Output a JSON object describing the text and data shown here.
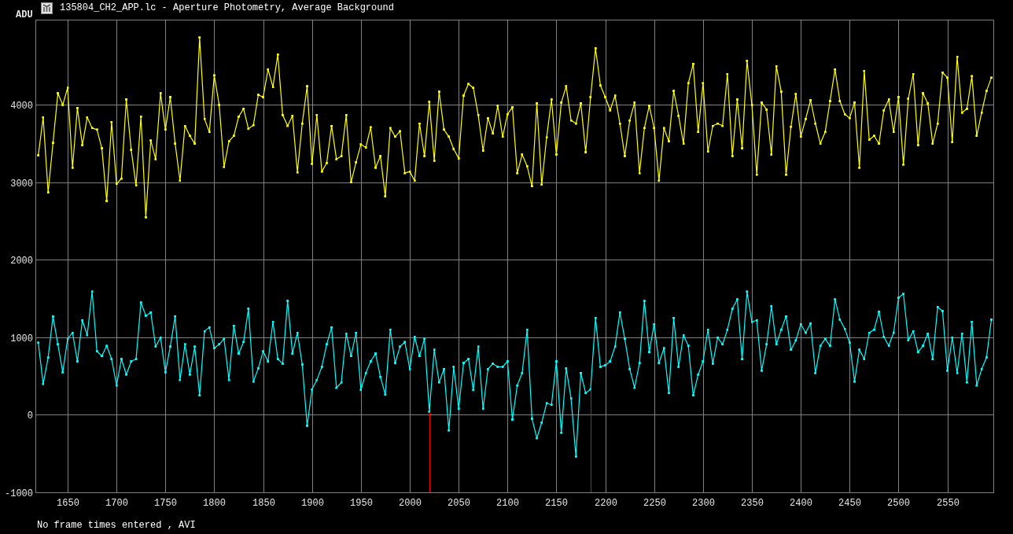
{
  "window": {
    "title": "135804_CH2_APP.lc - Aperture Photometry, Average Background"
  },
  "chart": {
    "chart_data": {
      "type": "line",
      "ylabel": "ADU",
      "x": [
        1620,
        1625,
        1630,
        1635,
        1640,
        1645,
        1650,
        1655,
        1660,
        1665,
        1670,
        1675,
        1680,
        1685,
        1690,
        1695,
        1700,
        1705,
        1710,
        1715,
        1720,
        1725,
        1730,
        1735,
        1740,
        1745,
        1750,
        1755,
        1760,
        1765,
        1770,
        1775,
        1780,
        1785,
        1790,
        1795,
        1800,
        1805,
        1810,
        1815,
        1820,
        1825,
        1830,
        1835,
        1840,
        1845,
        1850,
        1855,
        1860,
        1865,
        1870,
        1875,
        1880,
        1885,
        1890,
        1895,
        1900,
        1905,
        1910,
        1915,
        1920,
        1925,
        1930,
        1935,
        1940,
        1945,
        1950,
        1955,
        1960,
        1965,
        1970,
        1975,
        1980,
        1985,
        1990,
        1995,
        2000,
        2005,
        2010,
        2015,
        2020,
        2025,
        2030,
        2035,
        2040,
        2045,
        2050,
        2055,
        2060,
        2065,
        2070,
        2075,
        2080,
        2085,
        2090,
        2095,
        2100,
        2105,
        2110,
        2115,
        2120,
        2125,
        2130,
        2135,
        2140,
        2145,
        2150,
        2155,
        2160,
        2165,
        2170,
        2175,
        2180,
        2185,
        2190,
        2195,
        2200,
        2205,
        2210,
        2215,
        2220,
        2225,
        2230,
        2235,
        2240,
        2245,
        2250,
        2255,
        2260,
        2265,
        2270,
        2275,
        2280,
        2285,
        2290,
        2295,
        2300,
        2305,
        2310,
        2315,
        2320,
        2325,
        2330,
        2335,
        2340,
        2345,
        2350,
        2355,
        2360,
        2365,
        2370,
        2375,
        2380,
        2385,
        2390,
        2395,
        2400,
        2405,
        2410,
        2415,
        2420,
        2425,
        2430,
        2435,
        2440,
        2445,
        2450,
        2455,
        2460,
        2465,
        2470,
        2475,
        2480,
        2485,
        2490,
        2495,
        2500,
        2505,
        2510,
        2515,
        2520,
        2525,
        2530,
        2535,
        2540,
        2545,
        2550,
        2555,
        2560,
        2565,
        2570,
        2575,
        2580,
        2585,
        2590,
        2595
      ],
      "series": [
        {
          "color": "#ffff00",
          "values": [
            3350,
            3840,
            2870,
            3510,
            4150,
            4000,
            4220,
            3190,
            3960,
            3480,
            3840,
            3700,
            3680,
            3440,
            2760,
            3780,
            2980,
            3050,
            4070,
            3420,
            2960,
            3850,
            2550,
            3540,
            3300,
            4150,
            3680,
            4100,
            3500,
            3020,
            3730,
            3600,
            3500,
            4870,
            3820,
            3650,
            4380,
            4000,
            3200,
            3530,
            3600,
            3850,
            3950,
            3690,
            3740,
            4130,
            4100,
            4460,
            4230,
            4650,
            3870,
            3730,
            3860,
            3130,
            3760,
            4240,
            3240,
            3870,
            3140,
            3250,
            3730,
            3300,
            3340,
            3870,
            3000,
            3260,
            3490,
            3450,
            3710,
            3190,
            3340,
            2820,
            3700,
            3590,
            3660,
            3120,
            3140,
            3020,
            3760,
            3340,
            4040,
            3280,
            4170,
            3680,
            3590,
            3430,
            3310,
            4120,
            4270,
            4220,
            3870,
            3410,
            3830,
            3630,
            3990,
            3590,
            3880,
            3970,
            3120,
            3360,
            3210,
            2950,
            4020,
            2970,
            3580,
            4070,
            3360,
            4030,
            4240,
            3800,
            3760,
            4020,
            3390,
            4100,
            4730,
            4250,
            4100,
            3930,
            4120,
            3760,
            3340,
            3800,
            4030,
            3120,
            3700,
            3990,
            3700,
            3020,
            3700,
            3530,
            4180,
            3860,
            3500,
            4280,
            4530,
            3650,
            4280,
            3400,
            3730,
            3760,
            3730,
            4400,
            3340,
            4070,
            3440,
            4570,
            4000,
            3100,
            4030,
            3940,
            3360,
            4500,
            4170,
            3100,
            3720,
            4140,
            3590,
            3820,
            4060,
            3760,
            3500,
            3650,
            4050,
            4460,
            4050,
            3880,
            3830,
            4030,
            3190,
            4440,
            3550,
            3600,
            3500,
            3930,
            4070,
            3650,
            4100,
            3230,
            4080,
            4400,
            3480,
            4150,
            4020,
            3500,
            3760,
            4420,
            4350,
            3520,
            4620,
            3900,
            3950,
            4370,
            3600,
            3900,
            4180,
            4350
          ]
        },
        {
          "color": "#00ffff",
          "values": [
            930,
            400,
            740,
            1270,
            910,
            550,
            980,
            1060,
            690,
            1220,
            1030,
            1590,
            820,
            760,
            890,
            720,
            380,
            720,
            520,
            690,
            720,
            1450,
            1280,
            1320,
            880,
            1000,
            550,
            880,
            1270,
            450,
            910,
            520,
            880,
            250,
            1080,
            1130,
            860,
            910,
            980,
            450,
            1150,
            790,
            940,
            1370,
            430,
            600,
            820,
            690,
            1200,
            720,
            660,
            1470,
            790,
            1060,
            650,
            -140,
            330,
            450,
            620,
            910,
            1130,
            350,
            420,
            1050,
            760,
            1060,
            320,
            540,
            690,
            790,
            490,
            260,
            1100,
            670,
            880,
            940,
            590,
            1010,
            760,
            980,
            40,
            840,
            420,
            590,
            -200,
            620,
            80,
            670,
            720,
            320,
            880,
            80,
            590,
            660,
            620,
            620,
            690,
            -60,
            380,
            540,
            1100,
            -50,
            -300,
            -100,
            150,
            130,
            690,
            -230,
            600,
            210,
            -540,
            540,
            280,
            330,
            1250,
            620,
            640,
            690,
            880,
            1320,
            980,
            590,
            350,
            670,
            1470,
            810,
            1170,
            670,
            860,
            280,
            1250,
            620,
            1030,
            890,
            250,
            520,
            690,
            1100,
            660,
            1000,
            910,
            1100,
            1370,
            1490,
            720,
            1590,
            1200,
            1220,
            570,
            910,
            1400,
            910,
            1100,
            1270,
            840,
            960,
            1170,
            1060,
            1180,
            540,
            890,
            980,
            890,
            1490,
            1230,
            1110,
            930,
            430,
            840,
            720,
            1060,
            1100,
            1330,
            1010,
            890,
            1060,
            1510,
            1560,
            960,
            1080,
            810,
            890,
            1050,
            720,
            1390,
            1340,
            570,
            1000,
            540,
            1050,
            420,
            1200,
            380,
            590,
            740,
            1230
          ]
        }
      ],
      "xlim": [
        1617,
        2597
      ],
      "ylim": [
        -1000,
        5100
      ],
      "xticks": [
        1650,
        1700,
        1750,
        1800,
        1850,
        1900,
        1950,
        2000,
        2050,
        2100,
        2150,
        2200,
        2250,
        2300,
        2350,
        2400,
        2450,
        2500,
        2550
      ],
      "yticks": [
        -1000,
        0,
        1000,
        2000,
        3000,
        4000
      ],
      "grid": true,
      "ref_lines": [
        {
          "axis": "x",
          "value": 2020,
          "color": "#ff0000"
        },
        {
          "axis": "x",
          "value": 2185,
          "color": "#ff0000"
        }
      ]
    }
  },
  "status_bar": {
    "text": "No frame times entered , AVI"
  }
}
